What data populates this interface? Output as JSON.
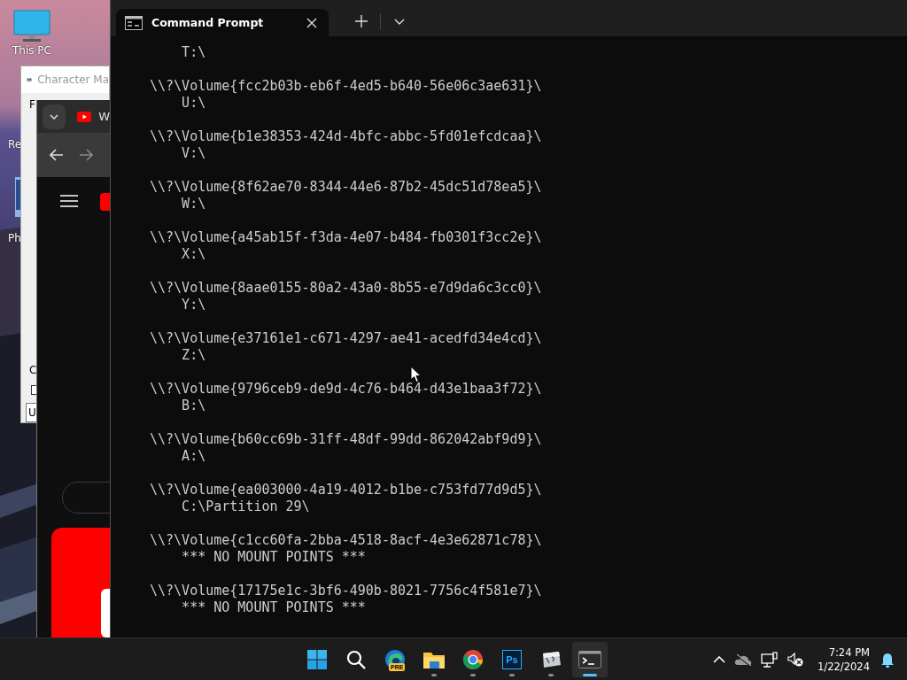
{
  "desktop": {
    "icons": [
      {
        "label": "This PC",
        "kind": "monitor"
      },
      {
        "label": "Re",
        "kind": "hidden"
      },
      {
        "label": "Ph",
        "kind": "shortcut"
      }
    ]
  },
  "character_map": {
    "title": "Character Ma",
    "font_label": "F",
    "copy_label": "C",
    "checkbox": {
      "checked": false
    },
    "field_value": "U"
  },
  "browser": {
    "tab_title": "W"
  },
  "terminal": {
    "tab_title": "Command Prompt",
    "output": [
      {
        "mount": "T:\\"
      },
      {
        "volume": "\\\\?\\Volume{fcc2b03b-eb6f-4ed5-b640-56e06c3ae631}\\",
        "mount": "U:\\"
      },
      {
        "volume": "\\\\?\\Volume{b1e38353-424d-4bfc-abbc-5fd01efcdcaa}\\",
        "mount": "V:\\"
      },
      {
        "volume": "\\\\?\\Volume{8f62ae70-8344-44e6-87b2-45dc51d78ea5}\\",
        "mount": "W:\\"
      },
      {
        "volume": "\\\\?\\Volume{a45ab15f-f3da-4e07-b484-fb0301f3cc2e}\\",
        "mount": "X:\\"
      },
      {
        "volume": "\\\\?\\Volume{8aae0155-80a2-43a0-8b55-e7d9da6c3cc0}\\",
        "mount": "Y:\\"
      },
      {
        "volume": "\\\\?\\Volume{e37161e1-c671-4297-ae41-acedfd34e4cd}\\",
        "mount": "Z:\\"
      },
      {
        "volume": "\\\\?\\Volume{9796ceb9-de9d-4c76-b464-d43e1baa3f72}\\",
        "mount": "B:\\"
      },
      {
        "volume": "\\\\?\\Volume{b60cc69b-31ff-48df-99dd-862042abf9d9}\\",
        "mount": "A:\\"
      },
      {
        "volume": "\\\\?\\Volume{ea003000-4a19-4012-b1be-c753fd77d9d5}\\",
        "mount": "C:\\Partition 29\\"
      },
      {
        "volume": "\\\\?\\Volume{c1cc60fa-2bba-4518-8acf-4e3e62871c78}\\",
        "mount": "*** NO MOUNT POINTS ***"
      },
      {
        "volume": "\\\\?\\Volume{17175e1c-3bf6-490b-8021-7756c4f581e7}\\",
        "mount": "*** NO MOUNT POINTS ***"
      }
    ]
  },
  "taskbar": {
    "apps": [
      {
        "kind": "start",
        "running": false,
        "active": false
      },
      {
        "kind": "search",
        "running": false,
        "active": false
      },
      {
        "kind": "edge",
        "badge": "PRE",
        "running": false,
        "active": false
      },
      {
        "kind": "folder",
        "running": true,
        "active": false
      },
      {
        "kind": "chrome",
        "running": true,
        "active": false
      },
      {
        "kind": "photoshop",
        "label": "Ps",
        "running": true,
        "active": false
      },
      {
        "kind": "charmap",
        "running": true,
        "active": false
      },
      {
        "kind": "terminal",
        "running": true,
        "active": true
      }
    ],
    "clock": {
      "time": "7:24 PM",
      "date": "1/22/2024"
    }
  }
}
